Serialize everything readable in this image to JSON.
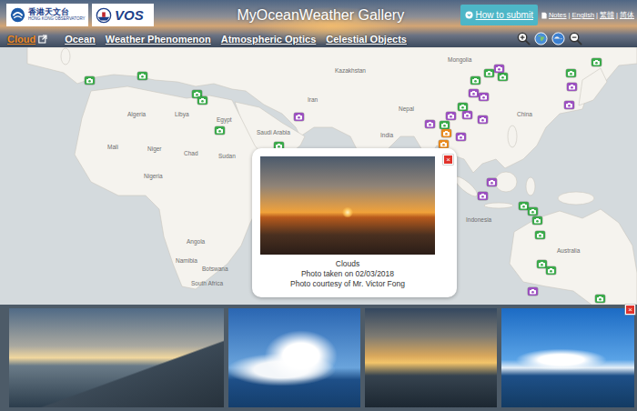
{
  "header": {
    "hko_logo": {
      "chinese": "香港天文台",
      "english": "HONG KONG OBSERVATORY"
    },
    "vos_logo": {
      "text": "VOS"
    },
    "title": "MyOceanWeather Gallery",
    "submit_button": "How to submit",
    "links": [
      "Notes",
      "English",
      "繁體",
      "简体"
    ],
    "separator": "|"
  },
  "nav": [
    {
      "label": "Cloud",
      "selected": true
    },
    {
      "label": "Ocean",
      "selected": false
    },
    {
      "label": "Weather Phenomenon",
      "selected": false
    },
    {
      "label": "Atmospheric Optics",
      "selected": false
    },
    {
      "label": "Celestial Objects",
      "selected": false
    }
  ],
  "map": {
    "labels": [
      "Algeria",
      "Libya",
      "Egypt",
      "Mali",
      "Niger",
      "Chad",
      "Sudan",
      "Nigeria",
      "Angola",
      "Namibia",
      "Botswana",
      "South Africa",
      "Saudi Arabia",
      "Iran",
      "Kazakhstan",
      "Mongolia",
      "India",
      "Nepal",
      "China",
      "Indonesia",
      "Australia"
    ],
    "markers": [
      {
        "color": "#3aaa4a"
      },
      {
        "color": "#3aaa4a"
      },
      {
        "color": "#3aaa4a"
      },
      {
        "color": "#3aaa4a"
      },
      {
        "color": "#3aaa4a"
      },
      {
        "color": "#3aaa4a"
      },
      {
        "color": "#9b4fc0"
      },
      {
        "color": "#3aaa4a"
      },
      {
        "color": "#3aaa4a"
      },
      {
        "color": "#3aaa4a"
      },
      {
        "color": "#3aaa4a"
      },
      {
        "color": "#9b4fc0"
      },
      {
        "color": "#3aaa4a"
      },
      {
        "color": "#3aaa4a"
      },
      {
        "color": "#9b4fc0"
      },
      {
        "color": "#9b4fc0"
      },
      {
        "color": "#9b4fc0"
      },
      {
        "color": "#9b4fc0"
      },
      {
        "color": "#9b4fc0"
      },
      {
        "color": "#9b4fc0"
      },
      {
        "color": "#3aaa4a"
      },
      {
        "color": "#9b4fc0"
      },
      {
        "color": "#e8891d"
      },
      {
        "color": "#e8891d"
      },
      {
        "color": "#9b4fc0"
      },
      {
        "color": "#9b4fc0"
      },
      {
        "color": "#9b4fc0"
      },
      {
        "color": "#9b4fc0"
      },
      {
        "color": "#3aaa4a"
      },
      {
        "color": "#3aaa4a"
      },
      {
        "color": "#3aaa4a"
      },
      {
        "color": "#3aaa4a"
      },
      {
        "color": "#3aaa4a"
      },
      {
        "color": "#3aaa4a"
      },
      {
        "color": "#9b4fc0"
      },
      {
        "color": "#3aaa4a"
      }
    ]
  },
  "popup": {
    "close": "×",
    "photo": {
      "kind": "sunset"
    },
    "caption": "Clouds",
    "date_line": "Photo taken on 02/03/2018",
    "credit": "Photo courtesy of Mr. Victor Fong"
  },
  "gallery": {
    "close": "×",
    "photos": [
      {
        "kind": "ship-sunset"
      },
      {
        "kind": "cumulus"
      },
      {
        "kind": "sunset-clouds"
      },
      {
        "kind": "blue-sky"
      }
    ]
  }
}
